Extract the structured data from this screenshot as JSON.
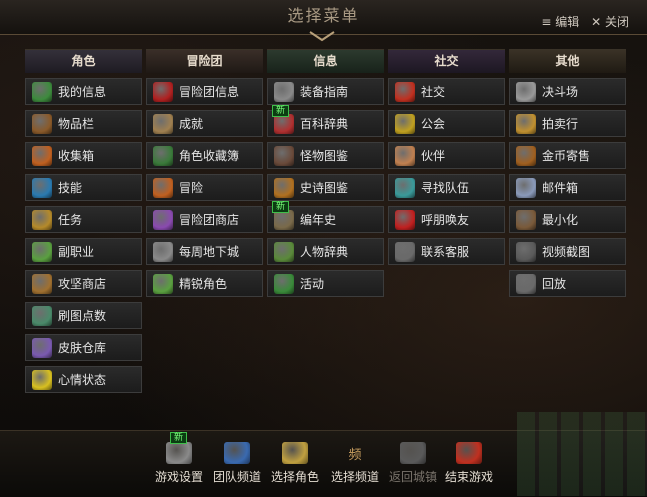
{
  "window": {
    "title": "选择菜单",
    "edit_label": "≡ 编辑",
    "close_label": "✕ 关闭"
  },
  "columns": [
    {
      "header": "角色",
      "items": [
        {
          "label": "我的信息",
          "icon": "person-icon",
          "color": "#3d8b3d"
        },
        {
          "label": "物品栏",
          "icon": "bag-icon",
          "color": "#8a5a2a"
        },
        {
          "label": "收集箱",
          "icon": "box-icon",
          "color": "#c06020"
        },
        {
          "label": "技能",
          "icon": "skill-icon",
          "color": "#2a7ab0"
        },
        {
          "label": "任务",
          "icon": "scroll-icon",
          "color": "#b58a2a"
        },
        {
          "label": "副职业",
          "icon": "potion-icon",
          "color": "#5aa040"
        },
        {
          "label": "攻坚商店",
          "icon": "chest-icon",
          "color": "#a07030"
        },
        {
          "label": "刷图点数",
          "icon": "medal-icon",
          "color": "#4a8a6a"
        },
        {
          "label": "皮肤仓库",
          "icon": "brush-icon",
          "color": "#7a5ab0"
        },
        {
          "label": "心情状态",
          "icon": "smile-icon",
          "color": "#d8c020"
        }
      ]
    },
    {
      "header": "冒险团",
      "items": [
        {
          "label": "冒险团信息",
          "icon": "banner-icon",
          "color": "#b02020"
        },
        {
          "label": "成就",
          "icon": "parchment-icon",
          "color": "#a08050"
        },
        {
          "label": "角色收藏簿",
          "icon": "card-icon",
          "color": "#3a7a3a"
        },
        {
          "label": "冒险",
          "icon": "flag-icon",
          "color": "#c06020"
        },
        {
          "label": "冒险团商店",
          "icon": "shop-icon",
          "color": "#8a4ab0"
        },
        {
          "label": "每周地下城",
          "icon": "gate-icon",
          "color": "#8a8a8a"
        },
        {
          "label": "精锐角色",
          "icon": "elite-icon",
          "color": "#5aa040"
        }
      ]
    },
    {
      "header": "信息",
      "items": [
        {
          "label": "装备指南",
          "icon": "armor-icon",
          "color": "#8a8a8a"
        },
        {
          "label": "百科辞典",
          "icon": "book-icon",
          "color": "#b03030",
          "new": "新"
        },
        {
          "label": "怪物图鉴",
          "icon": "monster-icon",
          "color": "#6a4a3a"
        },
        {
          "label": "史诗图鉴",
          "icon": "epic-book-icon",
          "color": "#b07020"
        },
        {
          "label": "编年史",
          "icon": "gear-icon",
          "color": "#7a6a4a",
          "new": "新"
        },
        {
          "label": "人物辞典",
          "icon": "figure-icon",
          "color": "#5a8a3a"
        },
        {
          "label": "活动",
          "icon": "calendar-icon",
          "color": "#3a8a3a"
        }
      ]
    },
    {
      "header": "社交",
      "items": [
        {
          "label": "社交",
          "icon": "shield-icon",
          "color": "#c03020"
        },
        {
          "label": "公会",
          "icon": "guild-icon",
          "color": "#c0a020"
        },
        {
          "label": "伙伴",
          "icon": "handshake-icon",
          "color": "#c08050"
        },
        {
          "label": "寻找队伍",
          "icon": "party-icon",
          "color": "#3a9a9a"
        },
        {
          "label": "呼朋唤友",
          "icon": "friends-icon",
          "color": "#c02020"
        },
        {
          "label": "联系客服",
          "icon": "headset-icon",
          "color": "#6a6a6a"
        }
      ]
    },
    {
      "header": "其他",
      "items": [
        {
          "label": "决斗场",
          "icon": "swords-icon",
          "color": "#9a9a9a"
        },
        {
          "label": "拍卖行",
          "icon": "gavel-icon",
          "color": "#c09030"
        },
        {
          "label": "金币寄售",
          "icon": "coin-bag-icon",
          "color": "#a06020"
        },
        {
          "label": "邮件箱",
          "icon": "mail-icon",
          "color": "#8a9aba"
        },
        {
          "label": "最小化",
          "icon": "minimize-icon",
          "color": "#7a5a3a"
        },
        {
          "label": "视频截图",
          "icon": "camera-icon",
          "color": "#5a5a5a"
        },
        {
          "label": "回放",
          "icon": "replay-icon",
          "color": "#6a6a6a"
        }
      ]
    }
  ],
  "bottom": [
    {
      "label": "游戏设置",
      "icon": "settings-gear-icon",
      "color": "#8a8a8a",
      "new": "新"
    },
    {
      "label": "团队频道",
      "icon": "team-shield-icon",
      "color": "#3a6ab0"
    },
    {
      "label": "选择角色",
      "icon": "character-icon",
      "color": "#c0a040"
    },
    {
      "label": "选择频道",
      "icon": "channel-icon",
      "glyph": "频",
      "color": "#caa060"
    },
    {
      "label": "返回城镇",
      "icon": "home-icon",
      "color": "#5a5a5a",
      "dim": true
    },
    {
      "label": "结束游戏",
      "icon": "power-icon",
      "color": "#c03020"
    }
  ]
}
